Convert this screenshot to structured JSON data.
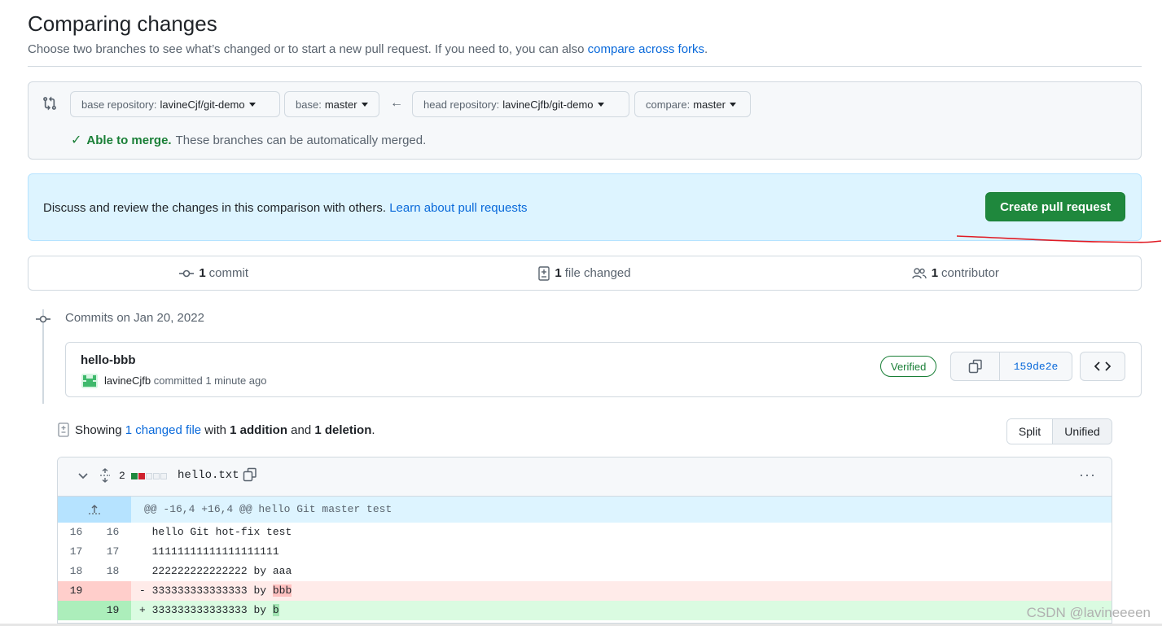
{
  "header": {
    "title": "Comparing changes",
    "subtitle": "Choose two branches to see what’s changed or to start a new pull request. If you need to, you can also",
    "subtitle_link": "compare across forks",
    "subtitle_end": "."
  },
  "range": {
    "base_repo_label": "base repository:",
    "base_repo_value": "lavineCjf/git-demo",
    "base_label": "base:",
    "base_value": "master",
    "arrow": "←",
    "head_repo_label": "head repository:",
    "head_repo_value": "lavineCjfb/git-demo",
    "compare_label": "compare:",
    "compare_value": "master",
    "merge_check": "✓",
    "merge_status": "Able to merge.",
    "merge_detail": "These branches can be automatically merged."
  },
  "blankslate": {
    "message": "Discuss and review the changes in this comparison with others.",
    "link": "Learn about pull requests",
    "button": "Create pull request"
  },
  "summary": {
    "commits_count": "1",
    "commits_label": "commit",
    "files_count": "1",
    "files_label": "file changed",
    "contributors_count": "1",
    "contributors_label": "contributor"
  },
  "commits": {
    "date_header": "Commits on Jan 20, 2022",
    "items": [
      {
        "title": "hello-bbb",
        "author": "lavineCjfb",
        "action": "committed",
        "time": "1 minute ago",
        "badge": "Verified",
        "sha": "159de2e"
      }
    ]
  },
  "toc": {
    "showing": "Showing",
    "changed_link": "1 changed file",
    "with": "with",
    "additions": "1 addition",
    "and": "and",
    "deletions": "1 deletion",
    "period": ".",
    "split_label": "Split",
    "unified_label": "Unified"
  },
  "file": {
    "diffstat": "2",
    "name": "hello.txt",
    "more": "···",
    "hunk": "@@ -16,4 +16,4 @@ hello Git master test",
    "lines": [
      {
        "type": "ctx",
        "old": "16",
        "new": "16",
        "sign": " ",
        "text": "hello Git hot-fix test"
      },
      {
        "type": "ctx",
        "old": "17",
        "new": "17",
        "sign": " ",
        "text": "11111111111111111111"
      },
      {
        "type": "ctx",
        "old": "18",
        "new": "18",
        "sign": " ",
        "text": "222222222222222 by aaa"
      },
      {
        "type": "del",
        "old": "19",
        "new": "",
        "sign": "-",
        "text": "333333333333333 by ",
        "hl": "bbb"
      },
      {
        "type": "add",
        "old": "",
        "new": "19",
        "sign": "+",
        "text": "333333333333333 by ",
        "hl": "b"
      }
    ]
  },
  "watermark": "CSDN @lavineeeen",
  "colors": {
    "accent": "#0969da",
    "success": "#1f883d",
    "annotation_red": "#e01b24"
  }
}
